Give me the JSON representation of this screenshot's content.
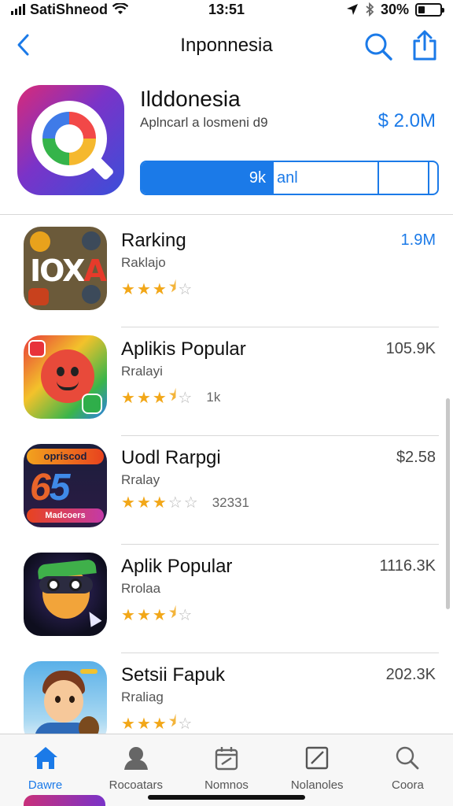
{
  "status_bar": {
    "carrier": "SatiShneod",
    "time": "13:51",
    "battery": "30%",
    "battery_level": 0.3
  },
  "nav": {
    "title": "Inponnesia",
    "back_icon": "chevron-left-icon",
    "search_icon": "search-icon",
    "share_icon": "share-icon"
  },
  "featured": {
    "title": "Ilddonesia",
    "subtitle": "Aplncarl a losmeni d9",
    "price": "$ 2.0M",
    "action_primary": "9k",
    "action_secondary": "anl"
  },
  "apps": [
    {
      "name": "Rarking",
      "subtitle": "Raklajo",
      "rating": 3.5,
      "rating_extra": "",
      "metric": "1.9M",
      "metric_accent": true
    },
    {
      "name": "Aplikis Popular",
      "subtitle": "Rralayi",
      "rating": 3.5,
      "rating_extra": "1k",
      "metric": "105.9K",
      "metric_accent": false
    },
    {
      "name": "Uodl Rarpgi",
      "subtitle": "Rralay",
      "rating": 3,
      "rating_extra": "32331",
      "metric": "$2.58",
      "metric_accent": false
    },
    {
      "name": "Aplik Popular",
      "subtitle": "Rrolaa",
      "rating": 3.5,
      "rating_extra": "",
      "metric": "1116.3K",
      "metric_accent": false
    },
    {
      "name": "Setsii Fapuk",
      "subtitle": "Rraliag",
      "rating": 3.5,
      "rating_extra": "",
      "metric": "202.3K",
      "metric_accent": false
    }
  ],
  "app_icon_text": {
    "icon1_text": "IOX",
    "icon1_accent": "A",
    "icon3_top": "opriscod",
    "icon3_big": "6",
    "icon3_big_accent": "5",
    "icon3_bottom": "Madcoers"
  },
  "tabs": [
    {
      "label": "Dawre",
      "icon": "home-icon",
      "active": true
    },
    {
      "label": "Rocoatars",
      "icon": "person-icon",
      "active": false
    },
    {
      "label": "Nomnos",
      "icon": "calendar-icon",
      "active": false
    },
    {
      "label": "Nolanoles",
      "icon": "edit-square-icon",
      "active": false
    },
    {
      "label": "Coora",
      "icon": "search-icon",
      "active": false
    }
  ],
  "colors": {
    "accent": "#1b7ae8",
    "star": "#f2a718",
    "star_empty": "#b9b9b9"
  }
}
